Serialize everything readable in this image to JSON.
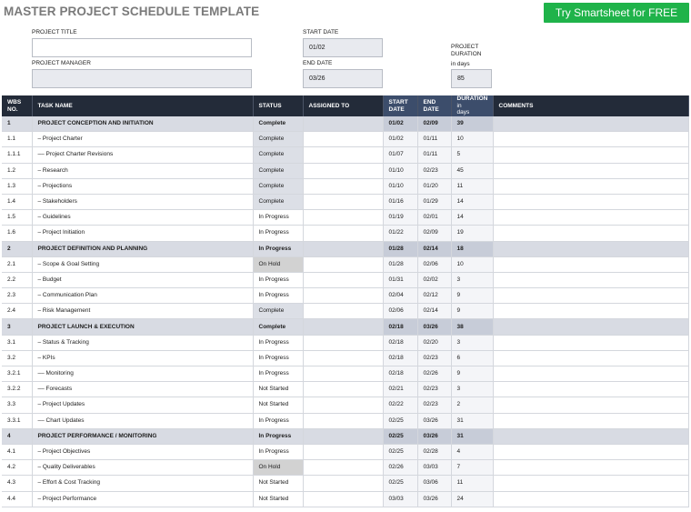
{
  "header": {
    "title": "MASTER PROJECT SCHEDULE TEMPLATE",
    "cta_label": "Try Smartsheet for FREE"
  },
  "fields": {
    "project_title_label": "PROJECT TITLE",
    "project_title_value": "",
    "project_manager_label": "PROJECT MANAGER",
    "project_manager_value": "",
    "start_date_label": "START DATE",
    "start_date_value": "01/02",
    "end_date_label": "END DATE",
    "end_date_value": "03/26",
    "duration_label_1": "PROJECT",
    "duration_label_2": "DURATION",
    "duration_label_3": "in days",
    "duration_value": "85"
  },
  "columns": {
    "wbs_1": "WBS",
    "wbs_2": "NO.",
    "task": "TASK NAME",
    "status": "STATUS",
    "assigned": "ASSIGNED TO",
    "start_1": "START",
    "start_2": "DATE",
    "end": "END DATE",
    "dur_1": "DURATION",
    "dur_in": "in",
    "dur_2": "days",
    "comments": "COMMENTS"
  },
  "rows": [
    {
      "wbs": "1",
      "task": "PROJECT CONCEPTION AND INITIATION",
      "status": "Complete",
      "assigned": "",
      "start": "01/02",
      "end": "02/09",
      "duration": "39",
      "comments": "",
      "phase": true,
      "indent": 0
    },
    {
      "wbs": "1.1",
      "task": "– Project Charter",
      "status": "Complete",
      "assigned": "",
      "start": "01/02",
      "end": "01/11",
      "duration": "10",
      "comments": "",
      "phase": false,
      "indent": 1
    },
    {
      "wbs": "1.1.1",
      "task": "–– Project Charter Revisions",
      "status": "Complete",
      "assigned": "",
      "start": "01/07",
      "end": "01/11",
      "duration": "5",
      "comments": "",
      "phase": false,
      "indent": 2
    },
    {
      "wbs": "1.2",
      "task": "– Research",
      "status": "Complete",
      "assigned": "",
      "start": "01/10",
      "end": "02/23",
      "duration": "45",
      "comments": "",
      "phase": false,
      "indent": 1
    },
    {
      "wbs": "1.3",
      "task": "– Projections",
      "status": "Complete",
      "assigned": "",
      "start": "01/10",
      "end": "01/20",
      "duration": "11",
      "comments": "",
      "phase": false,
      "indent": 1
    },
    {
      "wbs": "1.4",
      "task": "– Stakeholders",
      "status": "Complete",
      "assigned": "",
      "start": "01/16",
      "end": "01/29",
      "duration": "14",
      "comments": "",
      "phase": false,
      "indent": 1
    },
    {
      "wbs": "1.5",
      "task": "– Guidelines",
      "status": "In Progress",
      "assigned": "",
      "start": "01/19",
      "end": "02/01",
      "duration": "14",
      "comments": "",
      "phase": false,
      "indent": 1
    },
    {
      "wbs": "1.6",
      "task": "– Project Initiation",
      "status": "In Progress",
      "assigned": "",
      "start": "01/22",
      "end": "02/09",
      "duration": "19",
      "comments": "",
      "phase": false,
      "indent": 1
    },
    {
      "wbs": "2",
      "task": "PROJECT DEFINITION AND PLANNING",
      "status": "In Progress",
      "assigned": "",
      "start": "01/28",
      "end": "02/14",
      "duration": "18",
      "comments": "",
      "phase": true,
      "indent": 0
    },
    {
      "wbs": "2.1",
      "task": "– Scope & Goal Setting",
      "status": "On Hold",
      "assigned": "",
      "start": "01/28",
      "end": "02/06",
      "duration": "10",
      "comments": "",
      "phase": false,
      "indent": 1
    },
    {
      "wbs": "2.2",
      "task": "– Budget",
      "status": "In Progress",
      "assigned": "",
      "start": "01/31",
      "end": "02/02",
      "duration": "3",
      "comments": "",
      "phase": false,
      "indent": 1
    },
    {
      "wbs": "2.3",
      "task": "– Communication Plan",
      "status": "In Progress",
      "assigned": "",
      "start": "02/04",
      "end": "02/12",
      "duration": "9",
      "comments": "",
      "phase": false,
      "indent": 1
    },
    {
      "wbs": "2.4",
      "task": "– Risk Management",
      "status": "Complete",
      "assigned": "",
      "start": "02/06",
      "end": "02/14",
      "duration": "9",
      "comments": "",
      "phase": false,
      "indent": 1
    },
    {
      "wbs": "3",
      "task": "PROJECT LAUNCH & EXECUTION",
      "status": "Complete",
      "assigned": "",
      "start": "02/18",
      "end": "03/26",
      "duration": "38",
      "comments": "",
      "phase": true,
      "indent": 0
    },
    {
      "wbs": "3.1",
      "task": "– Status & Tracking",
      "status": "In Progress",
      "assigned": "",
      "start": "02/18",
      "end": "02/20",
      "duration": "3",
      "comments": "",
      "phase": false,
      "indent": 1
    },
    {
      "wbs": "3.2",
      "task": "– KPIs",
      "status": "In Progress",
      "assigned": "",
      "start": "02/18",
      "end": "02/23",
      "duration": "6",
      "comments": "",
      "phase": false,
      "indent": 1
    },
    {
      "wbs": "3.2.1",
      "task": "–– Monitoring",
      "status": "In Progress",
      "assigned": "",
      "start": "02/18",
      "end": "02/26",
      "duration": "9",
      "comments": "",
      "phase": false,
      "indent": 2
    },
    {
      "wbs": "3.2.2",
      "task": "–– Forecasts",
      "status": "Not Started",
      "assigned": "",
      "start": "02/21",
      "end": "02/23",
      "duration": "3",
      "comments": "",
      "phase": false,
      "indent": 2
    },
    {
      "wbs": "3.3",
      "task": "– Project Updates",
      "status": "Not Started",
      "assigned": "",
      "start": "02/22",
      "end": "02/23",
      "duration": "2",
      "comments": "",
      "phase": false,
      "indent": 1
    },
    {
      "wbs": "3.3.1",
      "task": "–– Chart Updates",
      "status": "In Progress",
      "assigned": "",
      "start": "02/25",
      "end": "03/26",
      "duration": "31",
      "comments": "",
      "phase": false,
      "indent": 2
    },
    {
      "wbs": "4",
      "task": "PROJECT PERFORMANCE / MONITORING",
      "status": "In Progress",
      "assigned": "",
      "start": "02/25",
      "end": "03/26",
      "duration": "31",
      "comments": "",
      "phase": true,
      "indent": 0
    },
    {
      "wbs": "4.1",
      "task": "– Project Objectives",
      "status": "In Progress",
      "assigned": "",
      "start": "02/25",
      "end": "02/28",
      "duration": "4",
      "comments": "",
      "phase": false,
      "indent": 1
    },
    {
      "wbs": "4.2",
      "task": "– Quality Deliverables",
      "status": "On Hold",
      "assigned": "",
      "start": "02/26",
      "end": "03/03",
      "duration": "7",
      "comments": "",
      "phase": false,
      "indent": 1
    },
    {
      "wbs": "4.3",
      "task": "– Effort & Cost Tracking",
      "status": "Not Started",
      "assigned": "",
      "start": "02/25",
      "end": "03/06",
      "duration": "11",
      "comments": "",
      "phase": false,
      "indent": 1
    },
    {
      "wbs": "4.4",
      "task": "– Project Performance",
      "status": "Not Started",
      "assigned": "",
      "start": "03/03",
      "end": "03/26",
      "duration": "24",
      "comments": "",
      "phase": false,
      "indent": 1
    }
  ]
}
